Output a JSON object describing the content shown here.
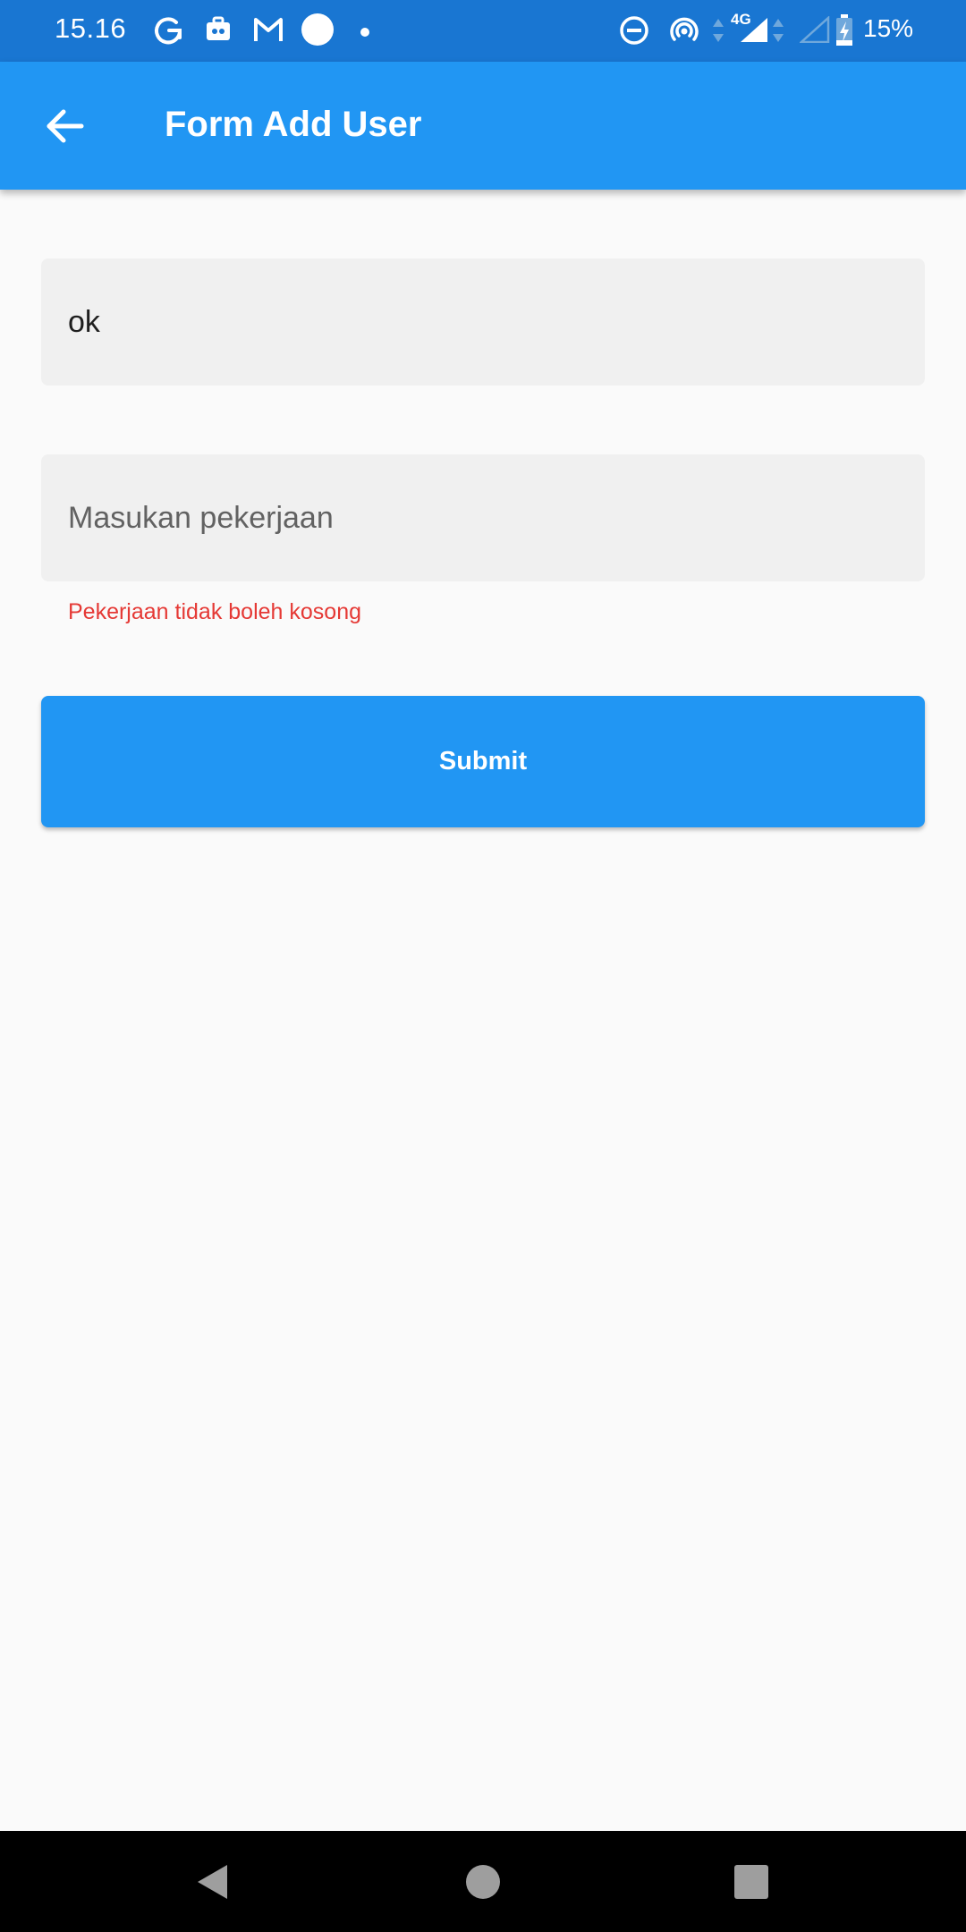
{
  "status_bar": {
    "time": "15.16",
    "battery": "15%",
    "network": "4G",
    "left_icons": [
      "grammarly-icon",
      "app-notification-icon",
      "gmail-icon",
      "circle-notification-icon",
      "more-notifications-dot"
    ],
    "right_icons": [
      "do-not-disturb-icon",
      "hotspot-icon",
      "signal-4g-icon",
      "signal-empty-icon",
      "battery-charging-icon"
    ]
  },
  "app_bar": {
    "title": "Form Add User",
    "back_icon": "arrow-back-icon"
  },
  "form": {
    "name_field": {
      "value": "ok"
    },
    "job_field": {
      "value": "",
      "placeholder": "Masukan pekerjaan",
      "error": "Pekerjaan tidak boleh kosong"
    },
    "submit_label": "Submit"
  },
  "colors": {
    "primary": "#2196F3",
    "status_bar": "#1976D2",
    "error": "#E53935",
    "field_fill": "#F0F0F0",
    "background": "#FAFAFA"
  },
  "nav_bar": {
    "icons": [
      "back-triangle-icon",
      "home-circle-icon",
      "recents-square-icon"
    ]
  }
}
